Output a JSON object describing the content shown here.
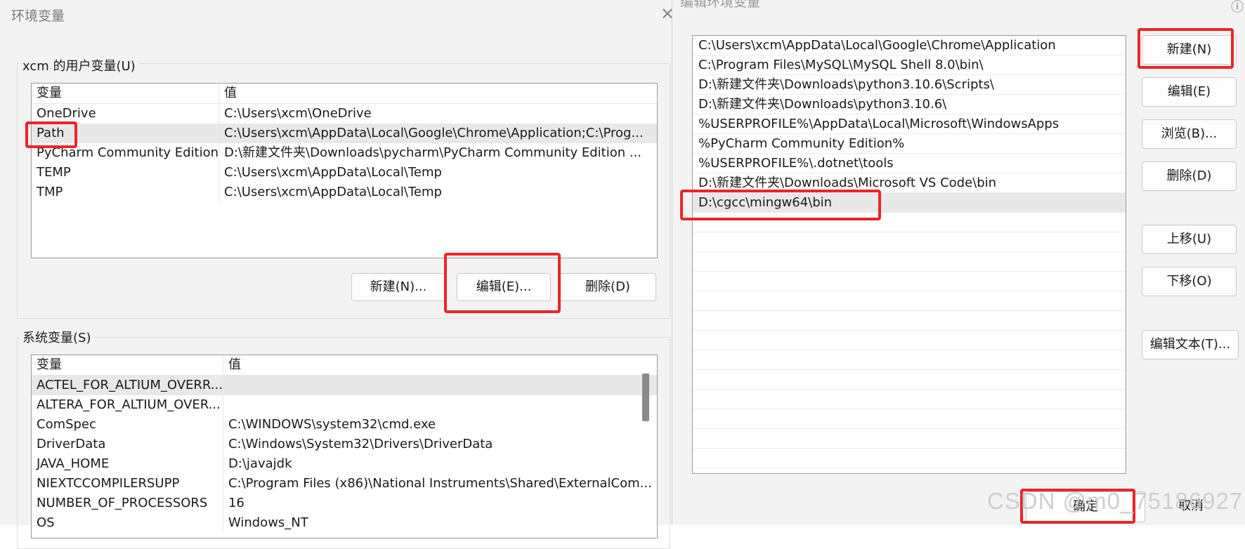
{
  "env_dialog": {
    "title": "环境变量",
    "close_symbol": "✕",
    "user_group": {
      "label": "xcm 的用户变量(U)",
      "headers": {
        "var": "变量",
        "val": "值"
      },
      "rows": [
        {
          "var": "OneDrive",
          "val": "C:\\Users\\xcm\\OneDrive"
        },
        {
          "var": "Path",
          "val": "C:\\Users\\xcm\\AppData\\Local\\Google\\Chrome\\Application;C:\\Prog..."
        },
        {
          "var": "PyCharm Community Edition",
          "val": "D:\\新建文件夹\\Downloads\\pycharm\\PyCharm Community Edition ..."
        },
        {
          "var": "TEMP",
          "val": "C:\\Users\\xcm\\AppData\\Local\\Temp"
        },
        {
          "var": "TMP",
          "val": "C:\\Users\\xcm\\AppData\\Local\\Temp"
        }
      ],
      "buttons": {
        "new": "新建(N)...",
        "edit": "编辑(E)...",
        "delete": "删除(D)"
      }
    },
    "sys_group": {
      "label": "系统变量(S)",
      "headers": {
        "var": "变量",
        "val": "值"
      },
      "rows": [
        {
          "var": "ACTEL_FOR_ALTIUM_OVERR...",
          "val": ""
        },
        {
          "var": "ALTERA_FOR_ALTIUM_OVER...",
          "val": ""
        },
        {
          "var": "ComSpec",
          "val": "C:\\WINDOWS\\system32\\cmd.exe"
        },
        {
          "var": "DriverData",
          "val": "C:\\Windows\\System32\\Drivers\\DriverData"
        },
        {
          "var": "JAVA_HOME",
          "val": "D:\\javajdk"
        },
        {
          "var": "NIEXTCCOMPILERSUPP",
          "val": "C:\\Program Files (x86)\\National Instruments\\Shared\\ExternalCom..."
        },
        {
          "var": "NUMBER_OF_PROCESSORS",
          "val": "16"
        },
        {
          "var": "OS",
          "val": "Windows_NT"
        }
      ]
    }
  },
  "edit_dialog": {
    "title": "编辑环境变量",
    "paths": [
      "C:\\Users\\xcm\\AppData\\Local\\Google\\Chrome\\Application",
      "C:\\Program Files\\MySQL\\MySQL Shell 8.0\\bin\\",
      "D:\\新建文件夹\\Downloads\\python3.10.6\\Scripts\\",
      "D:\\新建文件夹\\Downloads\\python3.10.6\\",
      "%USERPROFILE%\\AppData\\Local\\Microsoft\\WindowsApps",
      "%PyCharm Community Edition%",
      "%USERPROFILE%\\.dotnet\\tools",
      "D:\\新建文件夹\\Downloads\\Microsoft VS Code\\bin",
      "D:\\cgcc\\mingw64\\bin"
    ],
    "selected_path_index": 8,
    "buttons": {
      "new": "新建(N)",
      "edit": "编辑(E)",
      "browse": "浏览(B)...",
      "delete": "删除(D)",
      "up": "上移(U)",
      "down": "下移(O)",
      "edit_text": "编辑文本(T)...",
      "ok": "确定",
      "cancel": "取消"
    }
  },
  "watermark": "CSDN @m0_75186927",
  "colors": {
    "highlight": "#e8262a",
    "dialog_bg": "#f3f3f3",
    "selected_row": "#e8e8e8"
  }
}
